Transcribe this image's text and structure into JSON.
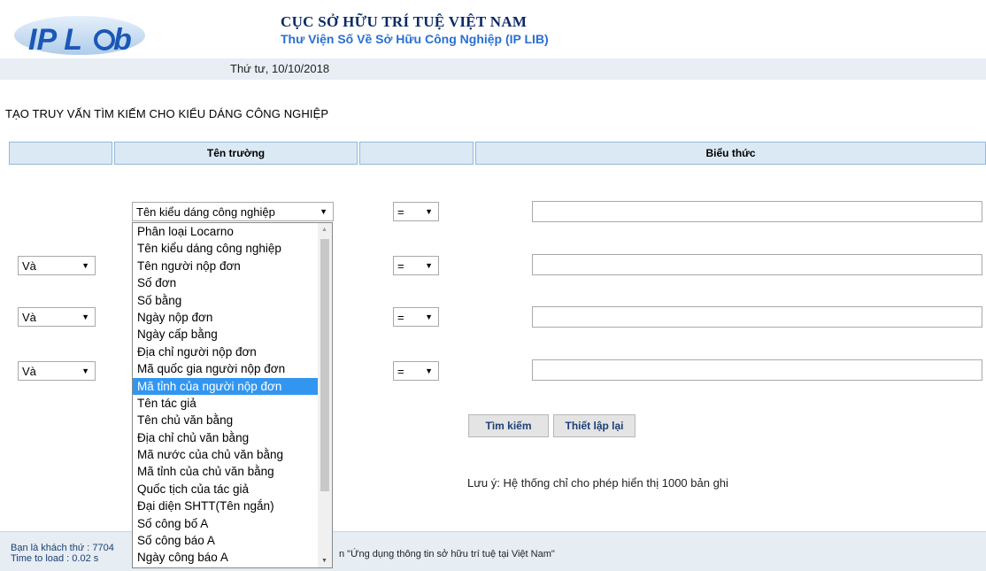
{
  "header": {
    "logo_text": "IP L@b",
    "org_title": "CỤC SỞ HỮU TRÍ TUỆ VIỆT NAM",
    "org_subtitle": "Thư Viện Số Về Sở Hữu Công Nghiệp (IP LIB)",
    "date": "Thứ tư, 10/10/2018"
  },
  "page_title": "TẠO TRUY VẤN TÌM KIẾM CHO KIỂU DÁNG CÔNG NGHIỆP",
  "columns": {
    "field_name": "Tên trường",
    "expression": "Biểu thức"
  },
  "rows": [
    {
      "logic": "",
      "field": "Tên kiểu dáng công nghiệp",
      "operator": "=",
      "value": ""
    },
    {
      "logic": "Và",
      "field": "",
      "operator": "=",
      "value": ""
    },
    {
      "logic": "Và",
      "field": "",
      "operator": "=",
      "value": ""
    },
    {
      "logic": "Và",
      "field": "",
      "operator": "=",
      "value": ""
    }
  ],
  "dropdown_options": [
    "Phân loại Locarno",
    "Tên kiểu dáng công nghiệp",
    "Tên người nộp đơn",
    "Số đơn",
    "Số bằng",
    "Ngày nộp đơn",
    "Ngày cấp bằng",
    "Địa chỉ người nộp đơn",
    "Mã quốc gia người nộp đơn",
    "Mã tỉnh của người nộp đơn",
    "Tên tác giả",
    "Tên chủ văn bằng",
    "Địa chỉ chủ văn bằng",
    "Mã nước của chủ văn bằng",
    "Mã tỉnh của chủ văn bằng",
    "Quốc tịch của tác giả",
    "Đại diện SHTT(Tên ngắn)",
    "Số công bố A",
    "Số công báo A",
    "Ngày công báo A"
  ],
  "dropdown_highlighted_index": 9,
  "buttons": {
    "search": "Tìm kiếm",
    "reset": "Thiết lập lại"
  },
  "note": "Lưu ý: Hệ thống chỉ cho phép hiển thị 1000 bản ghi",
  "footer": {
    "visitor_label": "Bạn là khách thứ : 7704",
    "load_time": "Time to load : 0.02 s",
    "text": "n \"Ứng dụng thông tin sở hữu trí tuệ tại Việt Nam\""
  },
  "colors": {
    "brand_dark": "#0b2a66",
    "brand_light": "#2a6fd1",
    "header_cell_bg": "#dbe9f5",
    "highlight": "#3296f0"
  }
}
